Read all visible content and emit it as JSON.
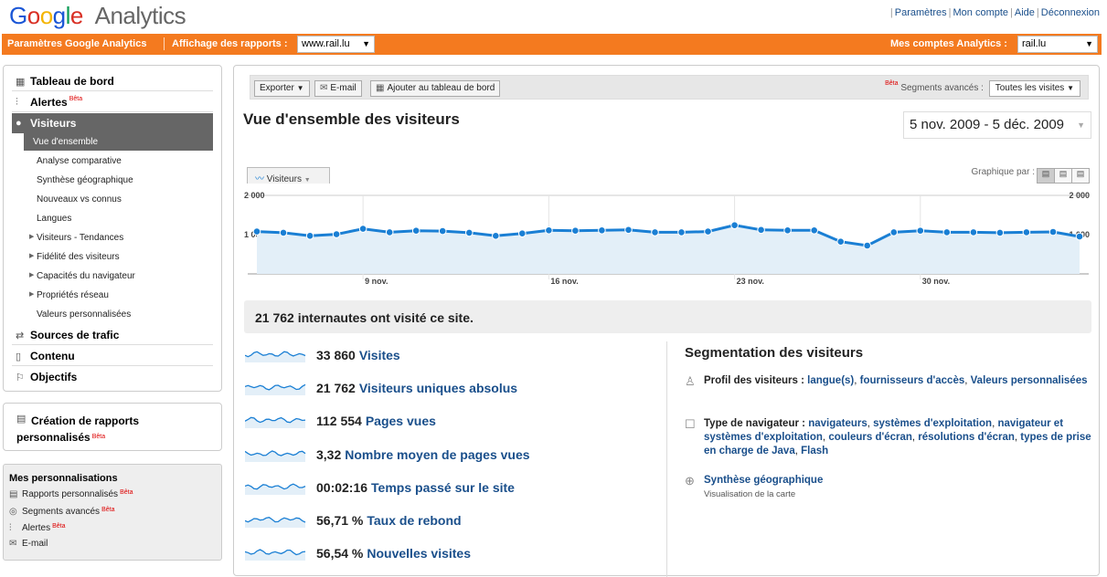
{
  "header": {
    "logo_google": [
      "G",
      "o",
      "o",
      "g",
      "l",
      "e"
    ],
    "logo_analytics": "Analytics",
    "links": [
      "Paramètres",
      "Mon compte",
      "Aide",
      "Déconnexion"
    ]
  },
  "orangebar": {
    "settings_link": "Paramètres Google Analytics",
    "report_view_label": "Affichage des rapports :",
    "report_view_value": "www.rail.lu",
    "accounts_label": "Mes comptes Analytics :",
    "accounts_value": "rail.lu"
  },
  "sidebar": {
    "main_items": [
      {
        "label": "Tableau de bord",
        "icon": "dashboard-icon"
      },
      {
        "label": "Alertes",
        "icon": "alert-chart-icon",
        "beta": "Bêta"
      },
      {
        "label": "Visiteurs",
        "icon": "user-icon"
      },
      {
        "label": "Sources de trafic",
        "icon": "traffic-icon"
      },
      {
        "label": "Contenu",
        "icon": "content-icon"
      },
      {
        "label": "Objectifs",
        "icon": "flag-icon"
      }
    ],
    "sub_items": [
      {
        "label": "Vue d'ensemble",
        "active": true
      },
      {
        "label": "Analyse comparative"
      },
      {
        "label": "Synthèse géographique"
      },
      {
        "label": "Nouveaux vs connus"
      },
      {
        "label": "Langues"
      },
      {
        "label": "Visiteurs - Tendances",
        "expandable": true
      },
      {
        "label": "Fidélité des visiteurs",
        "expandable": true
      },
      {
        "label": "Capacités du navigateur",
        "expandable": true
      },
      {
        "label": "Propriétés réseau",
        "expandable": true
      },
      {
        "label": "Valeurs personnalisées"
      }
    ],
    "custom_reports": {
      "label": "Création de rapports personnalisés",
      "beta": "Bêta"
    },
    "personalizations": {
      "title": "Mes personnalisations",
      "items": [
        {
          "label": "Rapports personnalisés",
          "beta": "Bêta",
          "icon": "report-icon"
        },
        {
          "label": "Segments avancés",
          "beta": "Bêta",
          "icon": "segment-icon"
        },
        {
          "label": "Alertes",
          "beta": "Bêta",
          "icon": "alert-chart-icon"
        },
        {
          "label": "E-mail",
          "icon": "mail-icon"
        }
      ]
    }
  },
  "toolbar": {
    "export_label": "Exporter",
    "email_label": "E-mail",
    "add_dashboard_label": "Ajouter au tableau de bord",
    "beta": "Bêta",
    "segments_label": "Segments avancés :",
    "segments_value": "Toutes les visites"
  },
  "main": {
    "title": "Vue d'ensemble des visiteurs",
    "date_range": "5 nov. 2009 - 5 déc. 2009",
    "metric_selector": "Visiteurs",
    "graph_by_label": "Graphique par :",
    "summary": "21 762 internautes ont visité ce site."
  },
  "chart_data": {
    "type": "area",
    "series": [
      {
        "name": "Visiteurs",
        "values": [
          1080,
          1050,
          970,
          1010,
          1150,
          1060,
          1100,
          1090,
          1050,
          970,
          1030,
          1110,
          1100,
          1110,
          1120,
          1060,
          1060,
          1080,
          1240,
          1120,
          1110,
          1110,
          820,
          720,
          1060,
          1100,
          1060,
          1060,
          1050,
          1060,
          1070,
          950
        ]
      }
    ],
    "x_start": "5 nov.",
    "x_end": "5 déc.",
    "x_tick_labels": [
      "9 nov.",
      "16 nov.",
      "23 nov.",
      "30 nov."
    ],
    "y_tick_labels": [
      "2 000",
      "1 000"
    ],
    "ylim": [
      0,
      2000
    ],
    "color": "#1a7fd4",
    "fill": "#e3eff8"
  },
  "metrics": [
    {
      "value": "33 860",
      "label": "Visites"
    },
    {
      "value": "21 762",
      "label": "Visiteurs uniques absolus"
    },
    {
      "value": "112 554",
      "label": "Pages vues"
    },
    {
      "value": "3,32",
      "label": "Nombre moyen de pages vues"
    },
    {
      "value": "00:02:16",
      "label": "Temps passé sur le site"
    },
    {
      "value": "56,71 %",
      "label": "Taux de rebond"
    },
    {
      "value": "56,54 %",
      "label": "Nouvelles visites"
    }
  ],
  "segmentation": {
    "title": "Segmentation des visiteurs",
    "profile_label": "Profil des visiteurs :",
    "profile_links": [
      "langue(s)",
      "fournisseurs d'accès",
      "Valeurs personnalisées"
    ],
    "browser_label": "Type de navigateur :",
    "browser_links": [
      "navigateurs",
      "systèmes d'exploitation",
      "navigateur et systèmes d'exploitation",
      "couleurs d'écran",
      "résolutions d'écran",
      "types de prise en charge de Java",
      "Flash"
    ],
    "geo_link": "Synthèse géographique",
    "geo_sub": "Visualisation de la carte"
  }
}
